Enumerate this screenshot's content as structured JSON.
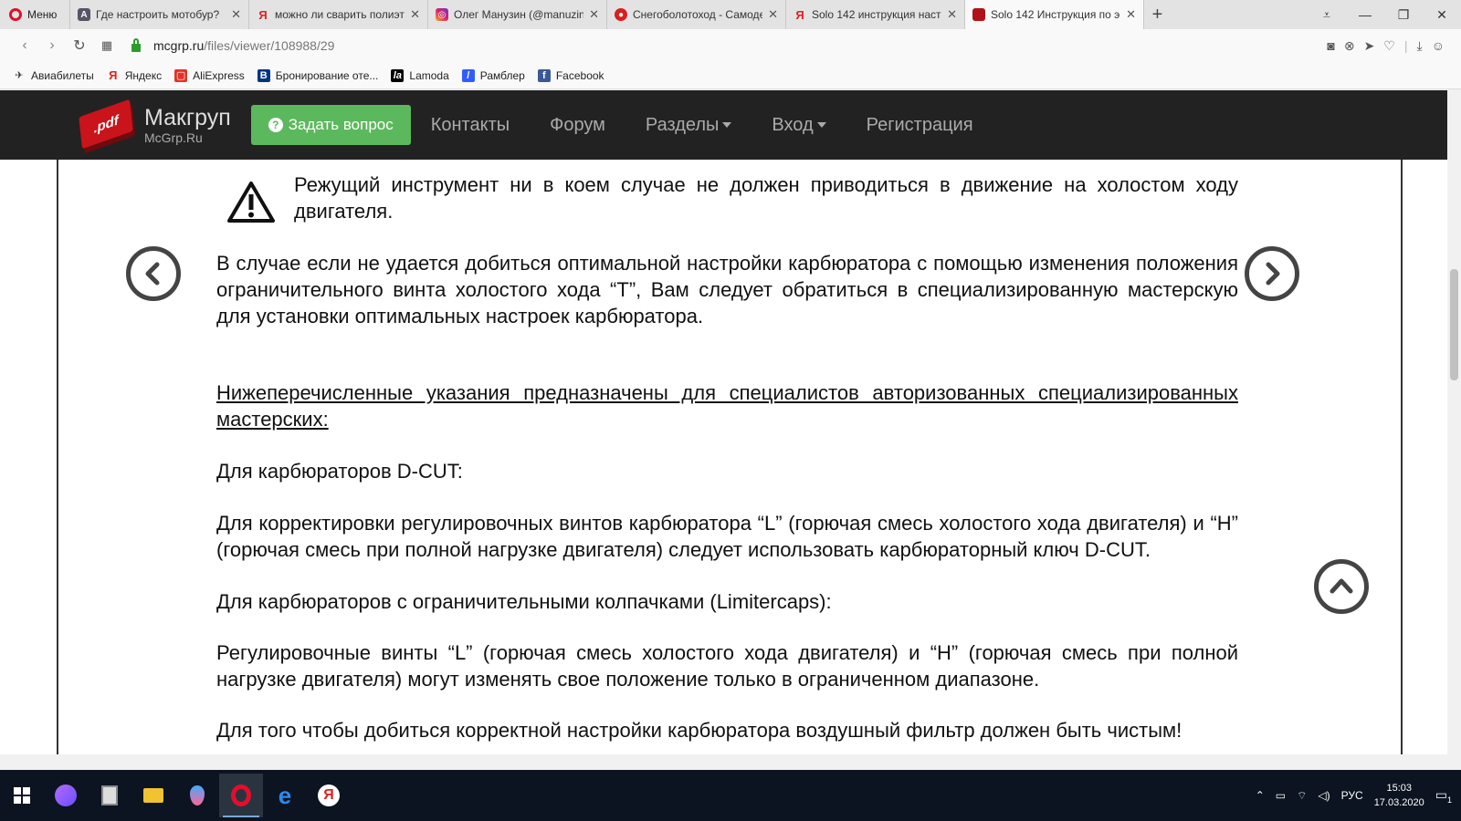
{
  "browser": {
    "menu_label": "Меню",
    "tabs": [
      {
        "title": "Где настроить мотобур?",
        "favicon": "forum-icon",
        "active": false
      },
      {
        "title": "можно ли сварить полиэт",
        "favicon": "yandex-icon",
        "active": false
      },
      {
        "title": "Олег Манузин (@manuzin",
        "favicon": "instagram-icon",
        "active": false
      },
      {
        "title": "Снегоболотоход - Самоде",
        "favicon": "site-icon",
        "active": false
      },
      {
        "title": "Solo 142 инструкция наст",
        "favicon": "yandex-icon",
        "active": false
      },
      {
        "title": "Solo 142 Инструкция по э",
        "favicon": "pdf-icon",
        "active": true
      }
    ],
    "new_tab": "+",
    "url_domain": "mcgrp.ru",
    "url_path": "/files/viewer/108988/29",
    "bookmarks": [
      {
        "label": "Авиабилеты",
        "icon": "plane-icon"
      },
      {
        "label": "Яндекс",
        "icon": "yandex-icon"
      },
      {
        "label": "AliExpress",
        "icon": "aliexpress-icon"
      },
      {
        "label": "Бронирование оте...",
        "icon": "booking-icon"
      },
      {
        "label": "Lamoda",
        "icon": "lamoda-icon"
      },
      {
        "label": "Рамблер",
        "icon": "rambler-icon"
      },
      {
        "label": "Facebook",
        "icon": "facebook-icon"
      }
    ]
  },
  "site": {
    "logo_badge": ".pdf",
    "logo_title": "Макгруп",
    "logo_subtitle": "McGrp.Ru",
    "ask_button": "Задать вопрос",
    "menu": [
      "Контакты",
      "Форум",
      "Разделы",
      "Вход",
      "Регистрация"
    ]
  },
  "document": {
    "warning": "Режущий инструмент ни в коем случае не должен приводиться в движение на холостом ходу двигателя.",
    "p1": "В случае если не удается добиться оптимальной настройки карбюратора с помощью изменения положения ограничительного винта холостого хода “T”, Вам следует обратиться в специализированную мастерскую для установки оптимальных настроек карбюратора.",
    "p2": "Нижеперечисленные указания предназначены для специалистов авторизованных специализированных мастерских:",
    "p3": "Для карбюраторов D-CUT:",
    "p4": "Для корректировки регулировочных винтов карбюратора “L” (горючая смесь холостого хода двигателя) и “H” (горючая смесь при полной нагрузке двигателя) следует использовать карбюраторный ключ D-CUT.",
    "p5": "Для карбюраторов с ограничительными колпачками (Limitercaps):",
    "p6": "Регулировочные винты “L” (горючая смесь холостого хода двигателя) и “H” (горючая смесь при полной нагрузке двигателя) могут изменять свое положение только в ограниченном диапазоне.",
    "p7": "Для того чтобы добиться корректной настройки карбюратора воздушный фильтр должен быть чистым!"
  },
  "taskbar": {
    "language": "РУС",
    "time": "15:03",
    "date": "17.03.2020",
    "notifications": "1"
  }
}
